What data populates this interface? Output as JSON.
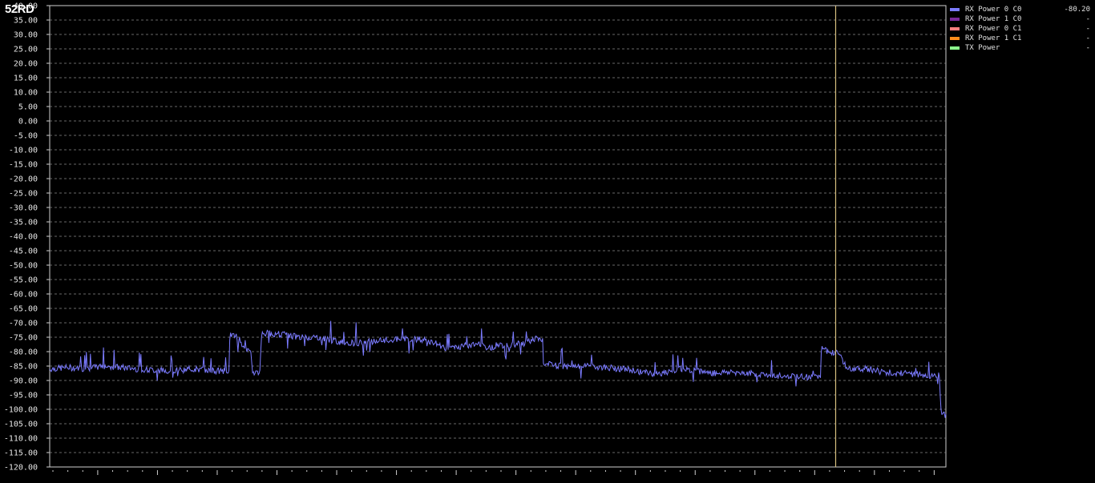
{
  "watermark": "52RD",
  "legend": [
    {
      "name": "RX Power 0 C0",
      "color": "#7b7bff",
      "value": "-80.20"
    },
    {
      "name": "RX Power 1 C0",
      "color": "#7a2a9a",
      "value": "-"
    },
    {
      "name": "RX Power 0 C1",
      "color": "#ff7f7f",
      "value": "-"
    },
    {
      "name": "RX Power 1 C1",
      "color": "#ff8c1a",
      "value": "-"
    },
    {
      "name": "TX Power",
      "color": "#8cff8c",
      "value": "-"
    }
  ],
  "colors": {
    "background": "#000000",
    "grid": "#8a8a8a",
    "axis": "#cfcfcf",
    "cursor": "#d8c080",
    "series": "#7b7bff"
  },
  "chart_data": {
    "type": "line",
    "title": "",
    "xlabel": "",
    "ylabel": "",
    "ylim": [
      -120,
      40
    ],
    "yticks": [
      "40.00",
      "35.00",
      "30.00",
      "25.00",
      "20.00",
      "15.00",
      "10.00",
      "5.00",
      "0.00",
      "-5.00",
      "-10.00",
      "-15.00",
      "-20.00",
      "-25.00",
      "-30.00",
      "-35.00",
      "-40.00",
      "-45.00",
      "-50.00",
      "-55.00",
      "-60.00",
      "-65.00",
      "-70.00",
      "-75.00",
      "-80.00",
      "-85.00",
      "-90.00",
      "-95.00",
      "-100.00",
      "-105.00",
      "-110.00",
      "-115.00",
      "-120.00"
    ],
    "grid": true,
    "legend_position": "right",
    "cursor_x": 0.877,
    "series": [
      {
        "name": "RX Power 0 C0",
        "x": [
          0.0,
          0.02,
          0.04,
          0.06,
          0.08,
          0.1,
          0.12,
          0.14,
          0.16,
          0.18,
          0.2,
          0.201,
          0.21,
          0.22,
          0.225,
          0.226,
          0.235,
          0.236,
          0.24,
          0.26,
          0.28,
          0.3,
          0.32,
          0.34,
          0.36,
          0.38,
          0.4,
          0.42,
          0.43,
          0.44,
          0.45,
          0.46,
          0.47,
          0.48,
          0.49,
          0.5,
          0.51,
          0.52,
          0.53,
          0.54,
          0.55,
          0.551,
          0.56,
          0.58,
          0.6,
          0.62,
          0.64,
          0.66,
          0.68,
          0.7,
          0.72,
          0.74,
          0.76,
          0.78,
          0.8,
          0.82,
          0.86,
          0.861,
          0.87,
          0.877,
          0.88,
          0.885,
          0.89,
          0.91,
          0.93,
          0.95,
          0.97,
          0.99,
          0.992,
          0.995,
          0.997,
          1.0
        ],
        "y": [
          -86,
          -85.5,
          -86,
          -85,
          -85.5,
          -86,
          -86.5,
          -86.5,
          -86,
          -86.5,
          -87,
          -74,
          -75,
          -80,
          -80,
          -87,
          -87,
          -74,
          -73.5,
          -74,
          -75,
          -75,
          -76.5,
          -77,
          -76.5,
          -76,
          -75.5,
          -76,
          -77,
          -78.5,
          -79,
          -78,
          -78,
          -77,
          -79,
          -77.5,
          -78,
          -77.5,
          -77,
          -75.5,
          -76,
          -84.5,
          -84.5,
          -85.5,
          -85,
          -85.5,
          -86,
          -87,
          -88,
          -86,
          -86.5,
          -87.5,
          -87,
          -87.5,
          -88,
          -88.5,
          -89,
          -79,
          -80,
          -80.2,
          -81,
          -83,
          -86,
          -86,
          -87,
          -87.5,
          -88,
          -88.5,
          -88,
          -102,
          -102,
          -102
        ]
      }
    ]
  }
}
